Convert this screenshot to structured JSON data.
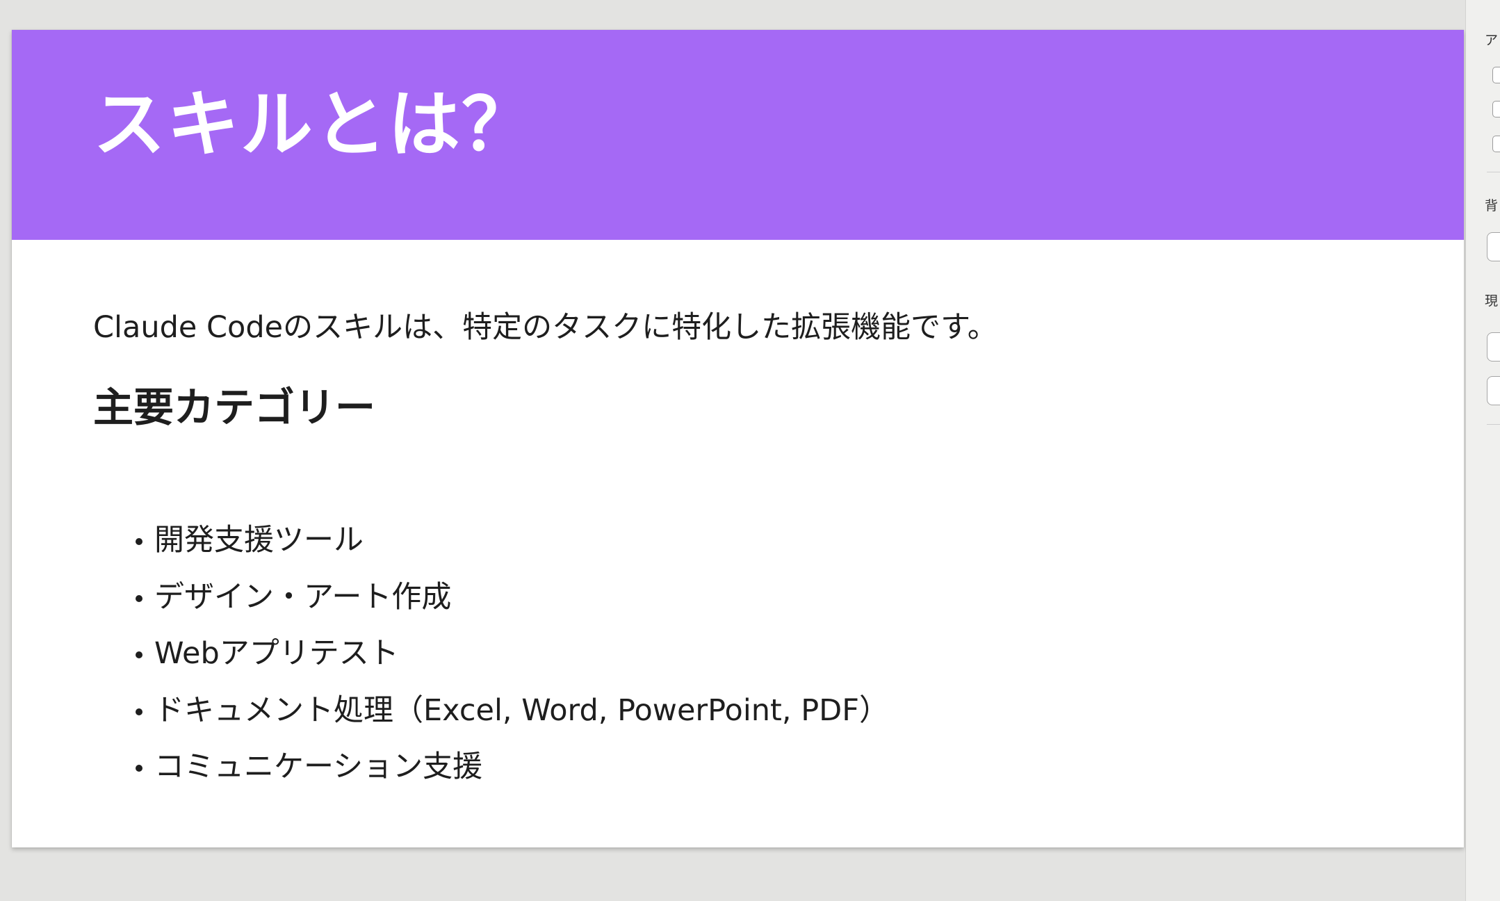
{
  "slide": {
    "title": "スキルとは？",
    "intro": "Claude Codeのスキルは、特定のタスクに特化した拡張機能です。",
    "section_heading": "主要カテゴリー",
    "bullets": [
      "開発支援ツール",
      "デザイン・アート作成",
      "Webアプリテスト",
      "ドキュメント処理（Excel, Word, PowerPoint, PDF）",
      "コミュニケーション支援"
    ]
  },
  "side_panel": {
    "labels": [
      "ア",
      "背",
      "現"
    ]
  },
  "colors": {
    "header_bg": "#a569f5",
    "title_text": "#ffffff",
    "body_text": "#1e1e1e",
    "workspace_bg": "#e3e3e1"
  }
}
